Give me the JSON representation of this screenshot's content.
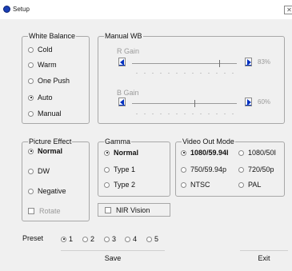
{
  "window": {
    "title": "Setup",
    "close_glyph": "✕"
  },
  "white_balance": {
    "title": "White Balance",
    "options": [
      "Cold",
      "Warm",
      "One Push",
      "Auto",
      "Manual"
    ],
    "selected": "Auto"
  },
  "manual_wb": {
    "title": "Manual WB",
    "r_gain": {
      "label": "R Gain",
      "value": "83%",
      "fraction": 0.83
    },
    "b_gain": {
      "label": "B Gain",
      "value": "60%",
      "fraction": 0.6
    }
  },
  "picture_effect": {
    "title": "Picture Effect",
    "options": [
      "Normal",
      "DW",
      "Negative"
    ],
    "selected": "Normal",
    "rotate_label": "Rotate",
    "rotate_checked": false
  },
  "gamma": {
    "title": "Gamma",
    "options": [
      "Normal",
      "Type 1",
      "Type 2"
    ],
    "selected": "Normal",
    "nir_label": "NIR Vision",
    "nir_checked": false
  },
  "video_out": {
    "title": "Video Out Mode",
    "options": [
      "1080/59.94I",
      "1080/50I",
      "750/59.94p",
      "720/50p",
      "NTSC",
      "PAL"
    ],
    "selected": "1080/59.94I"
  },
  "preset": {
    "label": "Preset",
    "options": [
      "1",
      "2",
      "3",
      "4",
      "5"
    ],
    "selected": "1"
  },
  "buttons": {
    "save": "Save",
    "exit": "Exit"
  },
  "colors": {
    "accent": "#0030c0",
    "disabled_text": "#9a9a9a",
    "background": "#f0f0f0"
  }
}
